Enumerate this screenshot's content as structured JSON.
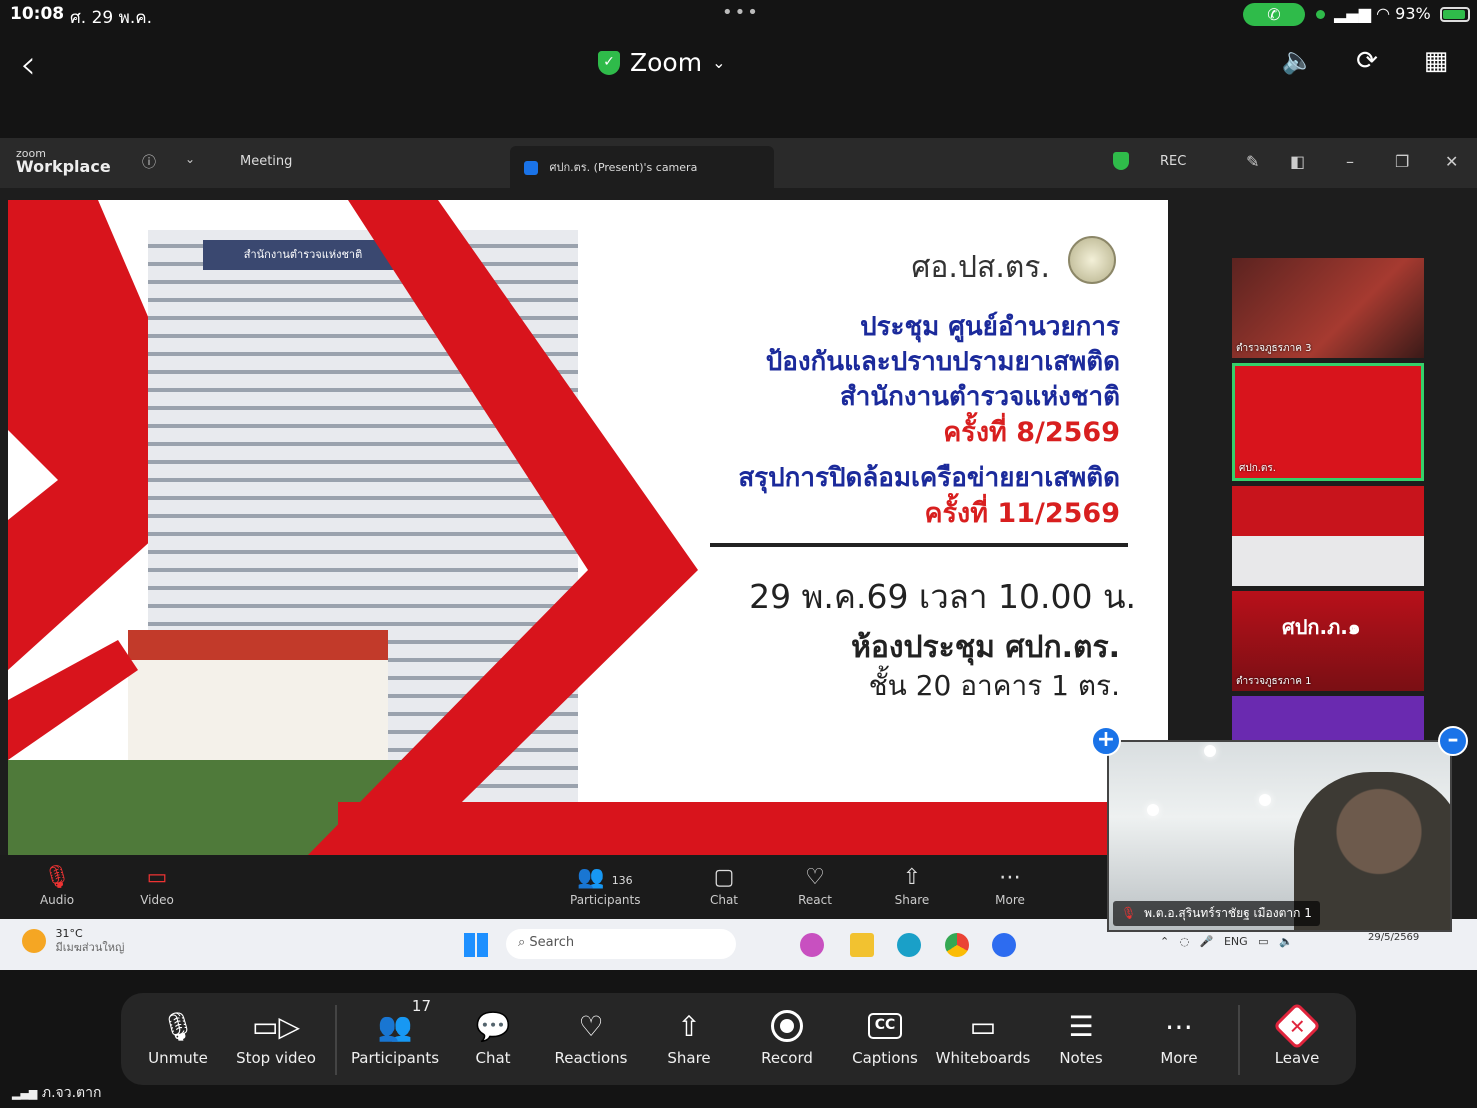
{
  "status_bar": {
    "time": "10:08",
    "date": "ศ. 29 พ.ค.",
    "battery": "93%",
    "carrier": "ภ.จว.ตาก"
  },
  "header": {
    "title": "Zoom",
    "accent": "#2fbb4a"
  },
  "pc_window": {
    "logo_small": "zoom",
    "logo_big": "Workplace",
    "meeting_label": "Meeting",
    "tab_label": "ศปก.ตร. (Present)'s camera",
    "rec_label": "REC"
  },
  "slide": {
    "building_sign": "สำนักงานตำรวจแห่งชาติ",
    "org": "ศอ.ปส.ตร.",
    "line1": "ประชุม ศูนย์อำนวยการ",
    "line2": "ป้องกันและปราบปรามยาเสพติด",
    "line3": "สำนักงานตำรวจแห่งชาติ",
    "line4": "ครั้งที่ 8/2569",
    "line5": "สรุปการปิดล้อมเครือข่ายยาเสพติด",
    "line6": "ครั้งที่ 11/2569",
    "date": "29 พ.ค.69 เวลา 10.00 น.",
    "room": "ห้องประชุม ศปก.ตร.",
    "floor": "ชั้น 20 อาคาร 1 ตร."
  },
  "strip": {
    "tiles": [
      {
        "caption": "ตำรวจภูธรภาค 3"
      },
      {
        "caption": "ศปก.ตร."
      },
      {
        "caption": ""
      },
      {
        "caption": "ตำรวจภูธรภาค 1"
      },
      {
        "caption": ""
      }
    ],
    "tile4_text": "ศปก.ภ.๑"
  },
  "pc_toolbar": {
    "audio": "Audio",
    "video": "Video",
    "participants": "Participants",
    "participants_count": "136",
    "chat": "Chat",
    "react": "React",
    "share": "Share",
    "more": "More"
  },
  "taskbar": {
    "weather_temp": "31°C",
    "weather_desc": "มีเมฆส่วนใหญ่",
    "search": "Search",
    "lang": "ENG",
    "date": "29/5/2569"
  },
  "self_video": {
    "name": "พ.ต.อ.สุรินทร์ราชัยฐ  เมืองตาก 1"
  },
  "toolbar": {
    "unmute": "Unmute",
    "stop_video": "Stop video",
    "participants": "Participants",
    "participants_count": "17",
    "chat": "Chat",
    "reactions": "Reactions",
    "share": "Share",
    "record": "Record",
    "captions": "Captions",
    "captions_icon": "CC",
    "whiteboards": "Whiteboards",
    "notes": "Notes",
    "more": "More",
    "leave": "Leave"
  }
}
